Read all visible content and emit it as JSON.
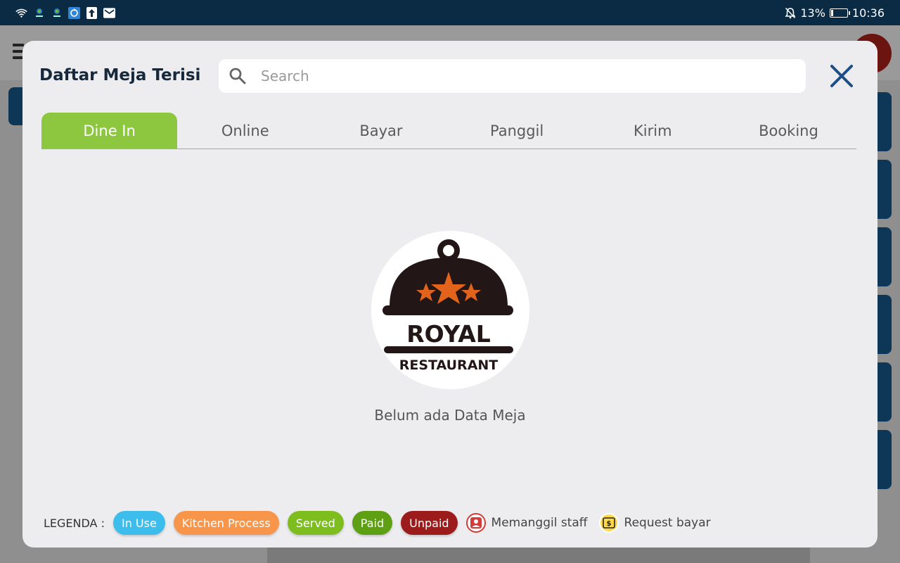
{
  "status_bar": {
    "battery": "13%",
    "battery_level": 0.13,
    "time": "10:36",
    "icons": [
      "wifi-icon",
      "app-icon",
      "app-icon",
      "sync-icon",
      "upload-icon",
      "mail-icon",
      "bell-off-icon",
      "battery-icon"
    ]
  },
  "modal": {
    "title": "Daftar Meja Terisi",
    "search": {
      "placeholder": "Search",
      "value": ""
    },
    "tabs": [
      {
        "label": "Dine In",
        "active": true
      },
      {
        "label": "Online",
        "active": false
      },
      {
        "label": "Bayar",
        "active": false
      },
      {
        "label": "Panggil",
        "active": false
      },
      {
        "label": "Kirim",
        "active": false
      },
      {
        "label": "Booking",
        "active": false
      }
    ],
    "logo": {
      "brand": "ROYAL",
      "subtitle": "RESTAURANT"
    },
    "empty_message": "Belum ada Data Meja",
    "legend": {
      "label": "LEGENDA :",
      "pills": [
        {
          "label": "In Use",
          "color": "#3dbdec"
        },
        {
          "label": "Kitchen Process",
          "color": "#f7964a"
        },
        {
          "label": "Served",
          "color": "#7dbe1e"
        },
        {
          "label": "Paid",
          "color": "#5f9f14"
        },
        {
          "label": "Unpaid",
          "color": "#9c1c1c"
        }
      ],
      "staff_call": "Memanggil staff",
      "request_bill": "Request bayar"
    }
  },
  "colors": {
    "accent_green": "#8dc63f",
    "close_blue": "#1b4f86",
    "title_navy": "#15283c",
    "status_bar": "#0b2a44"
  }
}
